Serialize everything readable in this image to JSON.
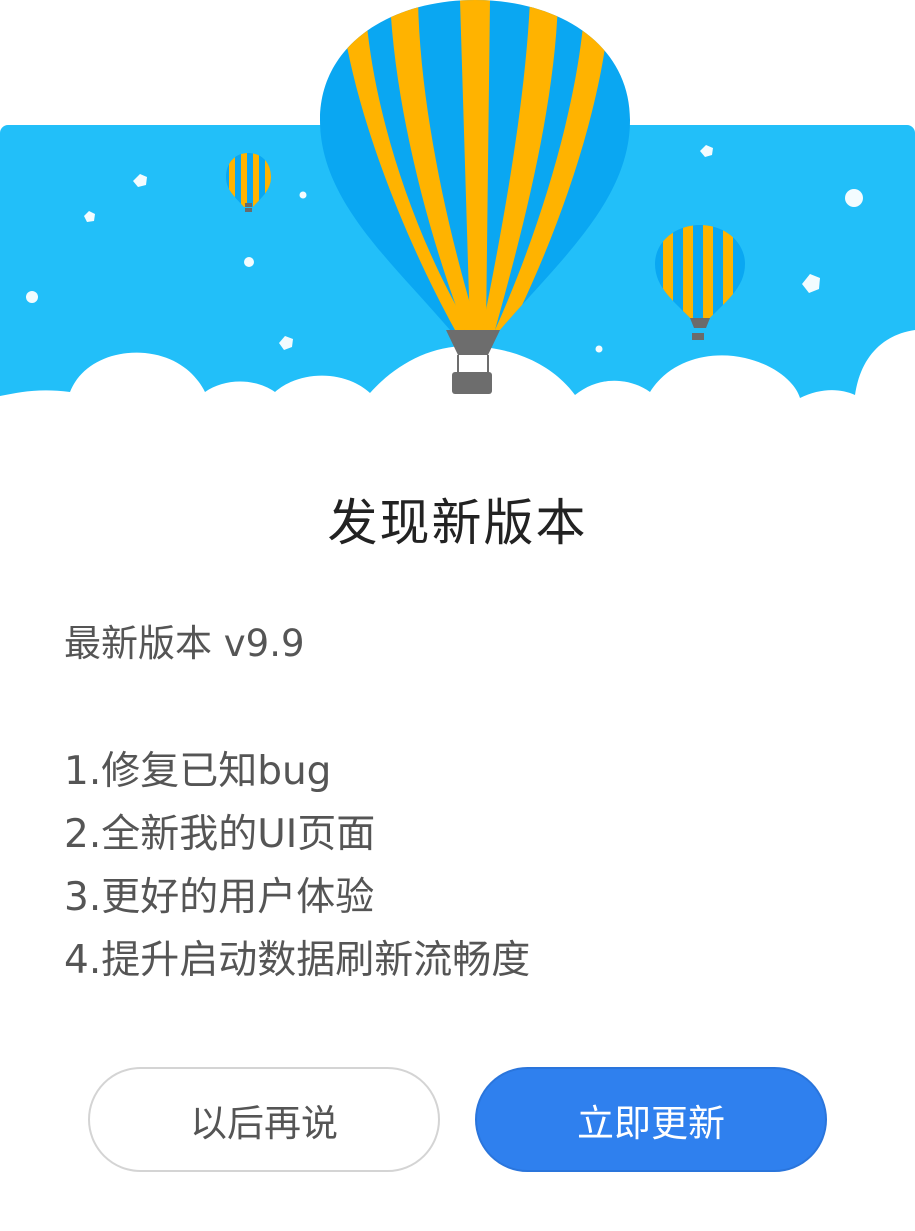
{
  "dialog": {
    "title": "发现新版本",
    "version_line": "最新版本 v9.9",
    "notes": [
      "1.修复已知bug",
      "2.全新我的UI页面",
      "3.更好的用户体验",
      "4.提升启动数据刷新流畅度"
    ],
    "buttons": {
      "later_label": "以后再说",
      "update_label": "立即更新"
    }
  },
  "colors": {
    "sky": "#22bff9",
    "balloon_blue": "#0aa7f2",
    "balloon_yellow": "#ffb300",
    "primary_button": "#2f80ee",
    "title_text": "#222222",
    "body_text": "#555555"
  },
  "illustration": {
    "icons": [
      "hot-air-balloon-large",
      "hot-air-balloon-small",
      "hot-air-balloon-medium",
      "clouds",
      "stars"
    ]
  }
}
